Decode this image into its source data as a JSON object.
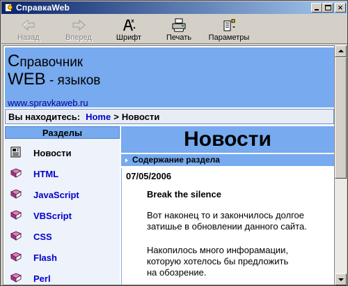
{
  "window": {
    "title": "СправкаWeb",
    "controls": {
      "minimize": "minimize",
      "maximize": "maximize",
      "close": "×"
    }
  },
  "toolbar": {
    "back": "Назад",
    "forward": "Вперед",
    "font": "Шрифт",
    "print": "Печать",
    "options": "Параметры"
  },
  "banner": {
    "line1_initial": "С",
    "line1_rest": "правочник",
    "line2_initial": "WEB",
    "line2_rest": " - языков",
    "url": "www.spravkaweb.ru"
  },
  "breadcrumb": {
    "prefix": "Вы находитесь:",
    "home": "Home",
    "separator": ">",
    "current": "Новости"
  },
  "sidebar": {
    "header": "Разделы",
    "items": [
      {
        "label": "Новости",
        "icon": "newspaper-icon",
        "active": true
      },
      {
        "label": "HTML",
        "icon": "book-icon",
        "active": false
      },
      {
        "label": "JavaScript",
        "icon": "book-icon",
        "active": false
      },
      {
        "label": "VBScript",
        "icon": "book-icon",
        "active": false
      },
      {
        "label": "CSS",
        "icon": "book-icon",
        "active": false
      },
      {
        "label": "Flash",
        "icon": "book-icon",
        "active": false
      },
      {
        "label": "Perl",
        "icon": "book-icon",
        "active": false
      }
    ]
  },
  "main": {
    "title": "Новости",
    "section": "Содержание раздела",
    "news": {
      "date": "07/05/2006",
      "headline": "Break the silence",
      "para1_l1": "Вот наконец то и закончилось долгое",
      "para1_l2": "затишье в обновлении данного сайта.",
      "para2_l1": "Накопилось много инфорамации,",
      "para2_l2": "которую хотелось бы предложить",
      "para2_l3": "на обозрение."
    }
  },
  "colors": {
    "accent": "#77aaee",
    "link": "#0000cc",
    "title_bar": "#0a246a"
  }
}
